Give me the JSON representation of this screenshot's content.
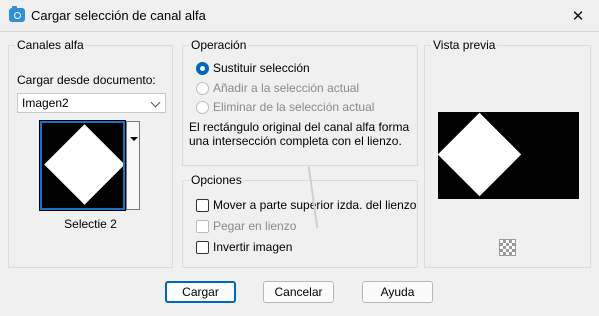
{
  "window": {
    "title": "Cargar selección de canal alfa",
    "close_icon": "close-icon"
  },
  "canales": {
    "title": "Canales alfa",
    "load_label": "Cargar desde documento:",
    "document_value": "Imagen2",
    "thumbnail_name": "Selectie 2"
  },
  "operacion": {
    "title": "Operación",
    "options": [
      {
        "label": "Sustituir selección",
        "checked": true,
        "enabled": true
      },
      {
        "label": "Añadir a la selección actual",
        "checked": false,
        "enabled": false
      },
      {
        "label": "Eliminar de la selección actual",
        "checked": false,
        "enabled": false
      }
    ],
    "description": "El rectángulo original del canal alfa forma una intersección completa con el lienzo."
  },
  "opciones": {
    "title": "Opciones",
    "items": [
      {
        "label": "Mover a parte superior izda. del lienzo",
        "checked": false,
        "enabled": true
      },
      {
        "label": "Pegar en lienzo",
        "checked": false,
        "enabled": false
      },
      {
        "label": "Invertir imagen",
        "checked": false,
        "enabled": true
      }
    ]
  },
  "vista": {
    "title": "Vista previa"
  },
  "buttons": {
    "ok": "Cargar",
    "cancel": "Cancelar",
    "help": "Ayuda"
  },
  "colors": {
    "accent": "#0067c0",
    "titlebar": "#f0f0f0"
  }
}
